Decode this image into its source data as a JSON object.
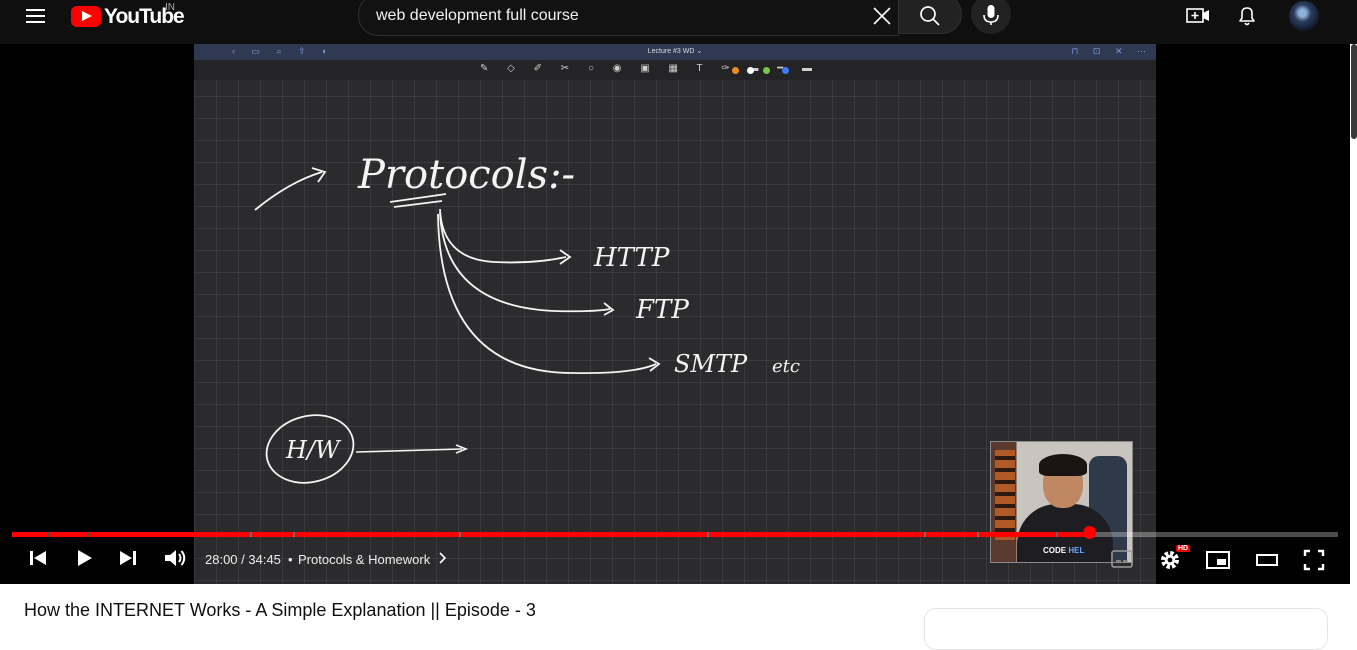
{
  "header": {
    "logo_text": "YouTube",
    "country_code": "IN",
    "search_value": "web development full course"
  },
  "video_frame": {
    "app_title": "Lecture #3 WD ⌄",
    "board_words": {
      "title": "Protocols:-",
      "item1": "HTTP",
      "item2": "FTP",
      "item3": "SMTP",
      "item3_suffix": "etc",
      "circle_label": "H/W"
    },
    "toolbar_colors": [
      "#f08a24",
      "#ffffff",
      "#7ac943",
      "#3d7df0"
    ],
    "pip_brand_a": "CODE ",
    "pip_brand_b": "HEL"
  },
  "player": {
    "progress_fraction": 0.812,
    "time_display": "28:00 / 34:45",
    "separator": "•",
    "chapter": "Protocols & Homework",
    "hd_badge": "HD"
  },
  "video": {
    "title": "How the INTERNET Works - A Simple Explanation || Episode - 3"
  }
}
